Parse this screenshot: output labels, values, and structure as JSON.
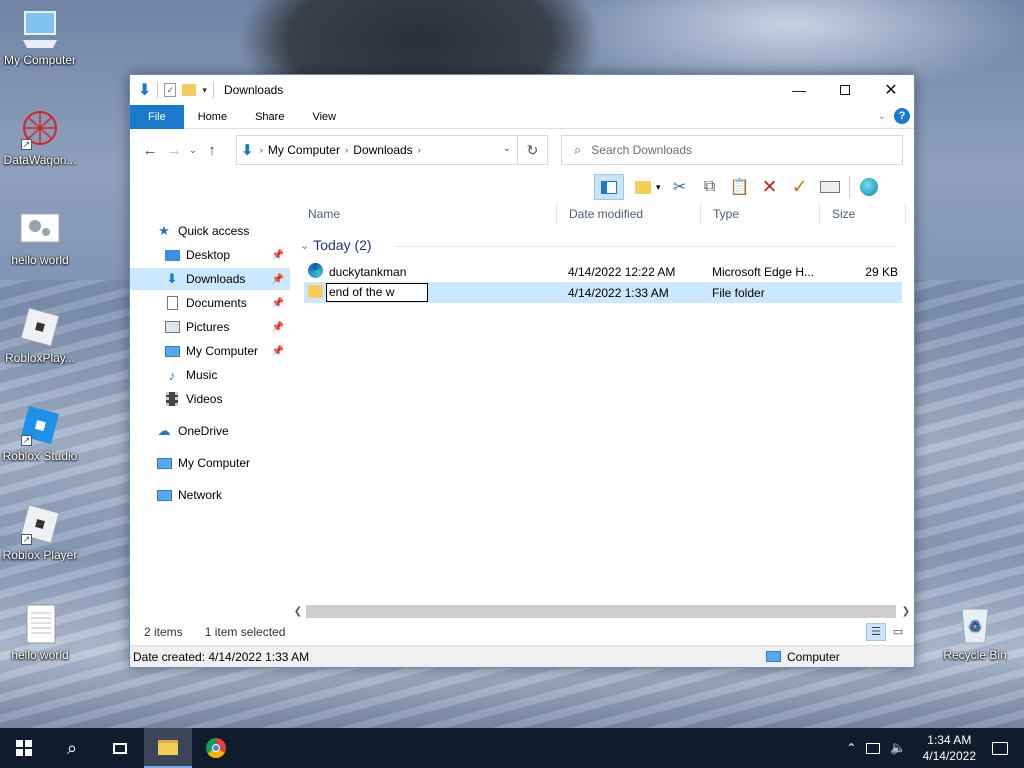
{
  "desktop": {
    "icons": [
      {
        "label": "My Computer",
        "icon": "computer-icon"
      },
      {
        "label": "DataWagon...",
        "icon": "datawagon-icon"
      },
      {
        "label": "hello world",
        "icon": "settings-file-icon"
      },
      {
        "label": "RobloxPlay...",
        "icon": "roblox-player-icon"
      },
      {
        "label": "Roblox Studio",
        "icon": "roblox-studio-icon"
      },
      {
        "label": "Roblox Player",
        "icon": "roblox-player-icon"
      },
      {
        "label": "hello world",
        "icon": "text-file-icon"
      },
      {
        "label": "Recycle Bin",
        "icon": "recycle-bin-icon"
      }
    ]
  },
  "window": {
    "title": "Downloads",
    "ribbon_tabs": [
      "File",
      "Home",
      "Share",
      "View"
    ],
    "address": {
      "segments": [
        "My Computer",
        "Downloads"
      ]
    },
    "search": {
      "placeholder": "Search Downloads"
    },
    "nav": {
      "quick_access": "Quick access",
      "items": [
        {
          "label": "Desktop",
          "pinned": true
        },
        {
          "label": "Downloads",
          "pinned": true,
          "selected": true
        },
        {
          "label": "Documents",
          "pinned": true
        },
        {
          "label": "Pictures",
          "pinned": true
        },
        {
          "label": "My Computer",
          "pinned": true
        },
        {
          "label": "Music",
          "pinned": false
        },
        {
          "label": "Videos",
          "pinned": false
        }
      ],
      "onedrive": "OneDrive",
      "my_computer": "My Computer",
      "network": "Network"
    },
    "columns": {
      "name": "Name",
      "date_modified": "Date modified",
      "type": "Type",
      "size": "Size"
    },
    "group": {
      "label": "Today (2)"
    },
    "files": [
      {
        "name": "duckytankman",
        "date": "4/14/2022 12:22 AM",
        "type": "Microsoft Edge H...",
        "size": "29 KB",
        "selected": false
      },
      {
        "name": "end of the w",
        "date": "4/14/2022 1:33 AM",
        "type": "File folder",
        "size": "",
        "selected": true,
        "renaming": true
      }
    ],
    "status": {
      "items": "2 items",
      "selected": "1 item selected"
    },
    "details": {
      "date_created": "Date created: 4/14/2022 1:33 AM",
      "location": "Computer"
    }
  },
  "taskbar": {
    "time": "1:34 AM",
    "date": "4/14/2022"
  },
  "colors": {
    "accent": "#1979ca",
    "selection": "#cce8ff",
    "taskbar": "#101b2e"
  }
}
